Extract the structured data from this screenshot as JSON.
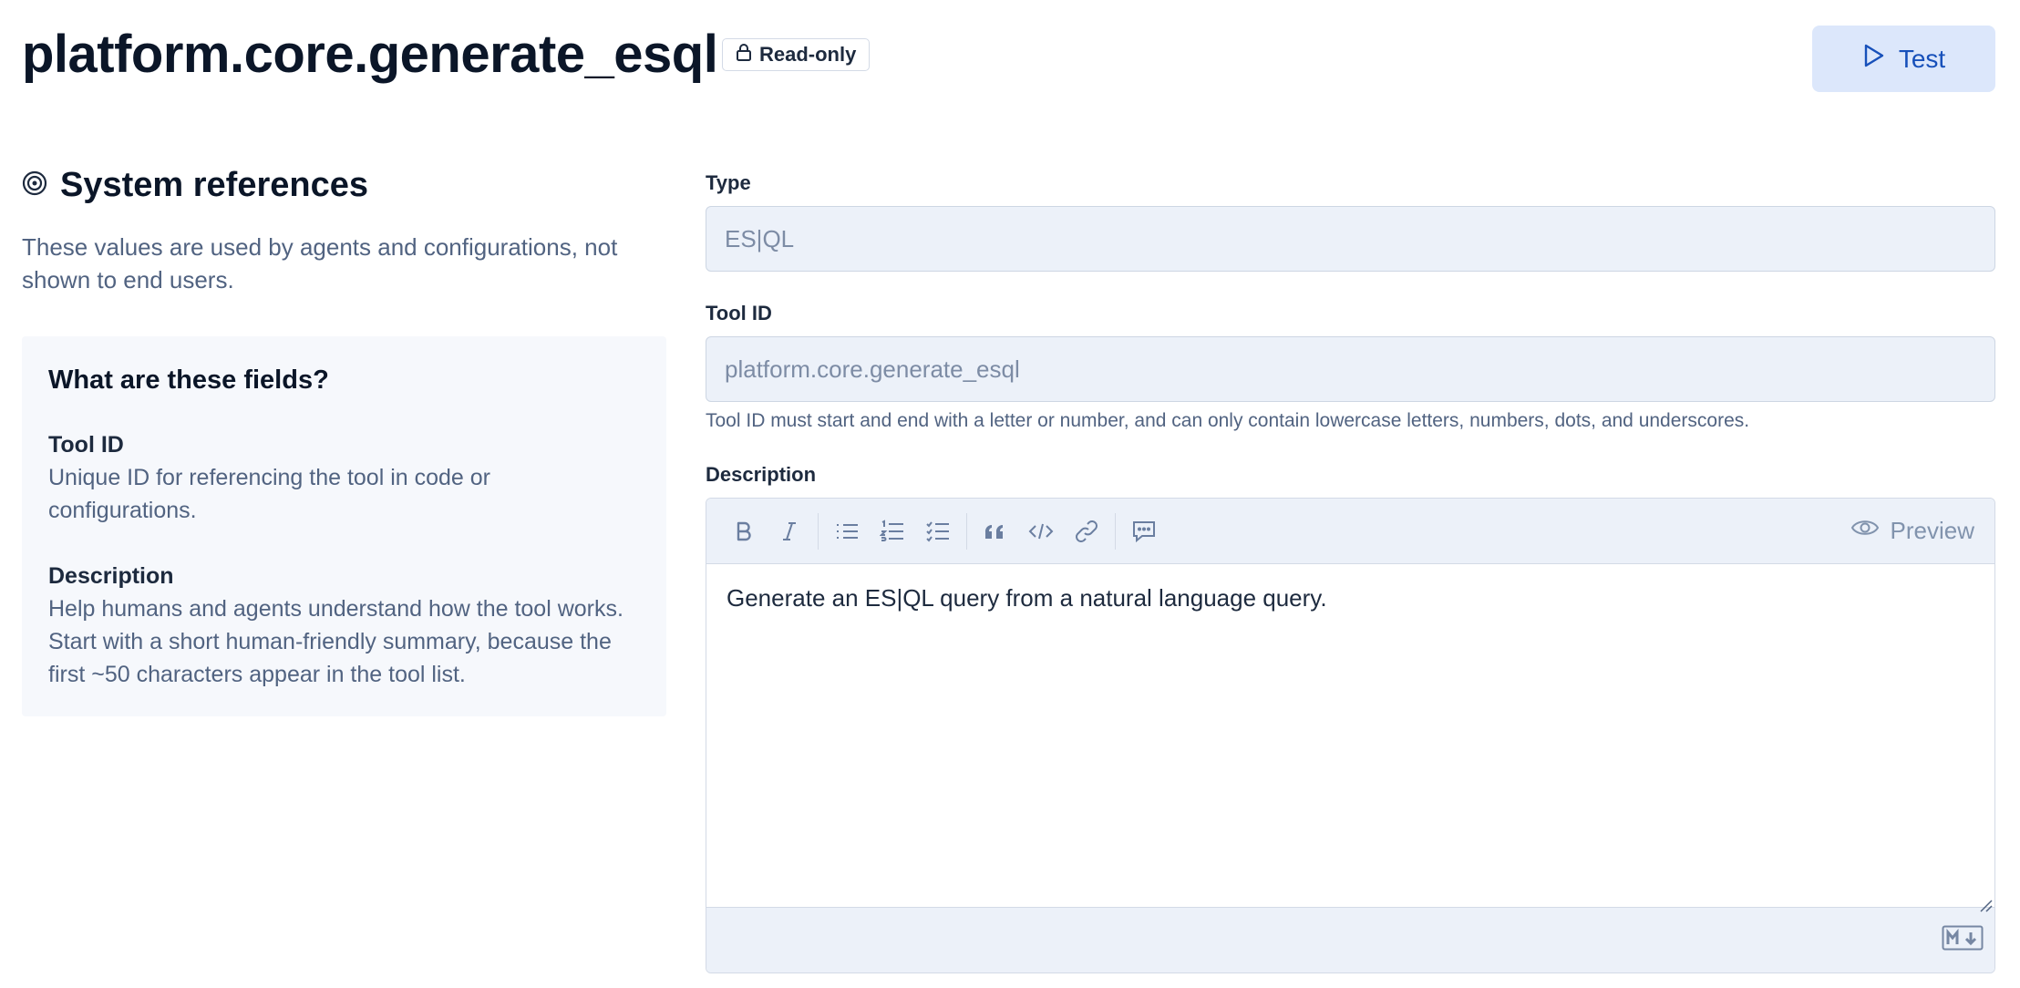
{
  "header": {
    "title": "platform.core.generate_esql",
    "badge_label": "Read-only",
    "test_label": "Test"
  },
  "left": {
    "section_title": "System references",
    "section_desc": "These values are used by agents and configurations, not shown to end users.",
    "help": {
      "heading": "What are these fields?",
      "items": [
        {
          "title": "Tool ID",
          "text": "Unique ID for referencing the tool in code or configurations."
        },
        {
          "title": "Description",
          "text": "Help humans and agents understand how the tool works. Start with a short human-friendly summary, because the first ~50 characters appear in the tool list."
        }
      ]
    }
  },
  "form": {
    "type": {
      "label": "Type",
      "value": "ES|QL"
    },
    "tool_id": {
      "label": "Tool ID",
      "value": "platform.core.generate_esql",
      "help": "Tool ID must start and end with a letter or number, and can only contain lowercase letters, numbers, dots, and underscores."
    },
    "description": {
      "label": "Description",
      "value": "Generate an ES|QL query from a natural language query.",
      "preview_label": "Preview",
      "toolbar_icons": [
        "bold-icon",
        "italic-icon",
        "bullet-list-icon",
        "numbered-list-icon",
        "checklist-icon",
        "quote-icon",
        "code-icon",
        "link-icon",
        "comment-icon"
      ]
    }
  },
  "colors": {
    "accent": "#1750ba",
    "accent_bg": "#dce7fb",
    "input_bg": "#ecf1f9",
    "panel_bg": "#f6f8fc"
  }
}
